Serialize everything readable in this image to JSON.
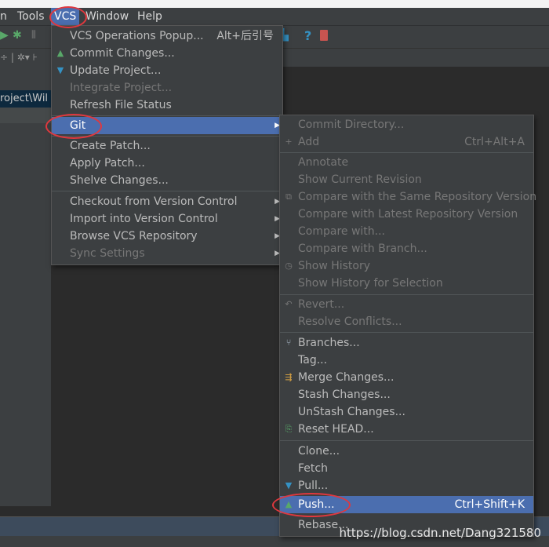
{
  "menubar": {
    "items": [
      "n",
      "Tools",
      "VCS",
      "Window",
      "Help"
    ]
  },
  "project_path": "roject\\Wil",
  "vcs_menu": {
    "items": [
      {
        "label": "VCS Operations Popup...",
        "shortcut": "Alt+后引号"
      },
      {
        "label": "Commit Changes..."
      },
      {
        "label": "Update Project..."
      },
      {
        "label": "Integrate Project..."
      },
      {
        "label": "Refresh File Status"
      },
      {
        "label": "Git"
      },
      {
        "label": "Create Patch..."
      },
      {
        "label": "Apply Patch..."
      },
      {
        "label": "Shelve Changes..."
      },
      {
        "label": "Checkout from Version Control"
      },
      {
        "label": "Import into Version Control"
      },
      {
        "label": "Browse VCS Repository"
      },
      {
        "label": "Sync Settings"
      }
    ]
  },
  "git_menu": {
    "items": [
      {
        "label": "Commit Directory..."
      },
      {
        "label": "Add",
        "shortcut": "Ctrl+Alt+A"
      },
      {
        "label": "Annotate"
      },
      {
        "label": "Show Current Revision"
      },
      {
        "label": "Compare with the Same Repository Version"
      },
      {
        "label": "Compare with Latest Repository Version"
      },
      {
        "label": "Compare with..."
      },
      {
        "label": "Compare with Branch..."
      },
      {
        "label": "Show History"
      },
      {
        "label": "Show History for Selection"
      },
      {
        "label": "Revert..."
      },
      {
        "label": "Resolve Conflicts..."
      },
      {
        "label": "Branches..."
      },
      {
        "label": "Tag..."
      },
      {
        "label": "Merge Changes..."
      },
      {
        "label": "Stash Changes..."
      },
      {
        "label": "UnStash Changes..."
      },
      {
        "label": "Reset HEAD..."
      },
      {
        "label": "Clone..."
      },
      {
        "label": "Fetch"
      },
      {
        "label": "Pull..."
      },
      {
        "label": "Push...",
        "shortcut": "Ctrl+Shift+K"
      },
      {
        "label": "Rebase..."
      }
    ]
  },
  "watermark": "https://blog.csdn.net/Dang321580",
  "colors": {
    "menu_bg": "#3c3f41",
    "selection": "#4b6eaf",
    "annotation_red": "#e0383e",
    "disabled_text": "#777777"
  }
}
